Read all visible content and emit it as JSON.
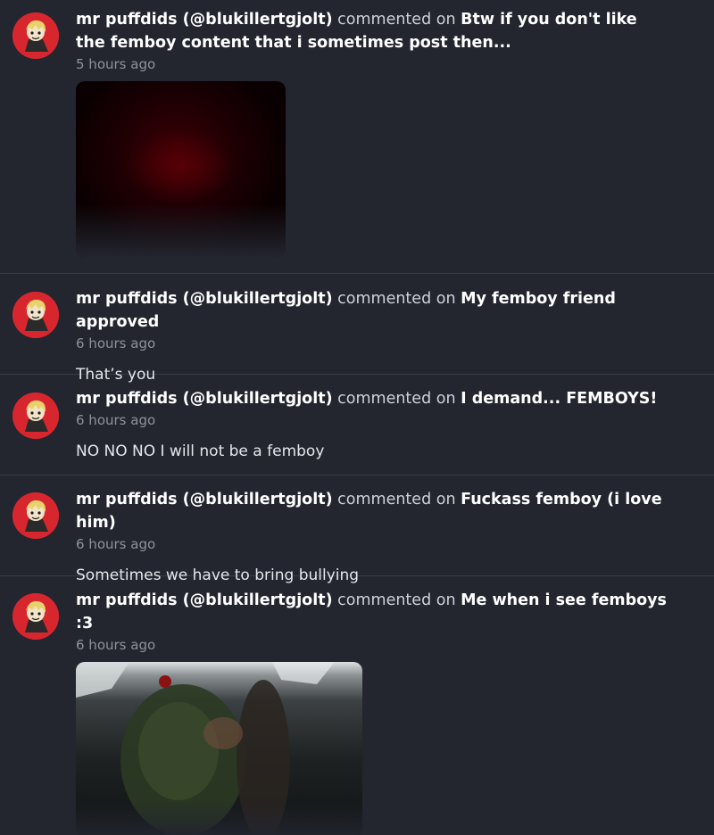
{
  "feed": {
    "items": [
      {
        "author": "mr puffdids (@blukillertgjolt)",
        "verb": "commented on",
        "post_title": "Btw if you don't like the femboy content that i sometimes post then...",
        "time": "5 hours ago",
        "text": "",
        "media": "dark red image"
      },
      {
        "author": "mr puffdids (@blukillertgjolt)",
        "verb": "commented on",
        "post_title": "My femboy friend approved",
        "time": "6 hours ago",
        "text": "That’s you"
      },
      {
        "author": "mr puffdids (@blukillertgjolt)",
        "verb": "commented on",
        "post_title": "I demand... FEMBOYS!",
        "time": "6 hours ago",
        "text": "NO NO NO  I will not be a femboy"
      },
      {
        "author": "mr puffdids (@blukillertgjolt)",
        "verb": "commented on",
        "post_title": "Fuckass femboy (i love him)",
        "time": "6 hours ago",
        "text": "Sometimes we have to bring bullying"
      },
      {
        "author": "mr puffdids (@blukillertgjolt)",
        "verb": "commented on",
        "post_title": "Me when i see femboys :3",
        "time": "6 hours ago",
        "text": "",
        "media": "dark creature image"
      }
    ]
  },
  "colors": {
    "background": "#23252f",
    "divider": "#3a3d49",
    "avatar_bg": "#d8262f",
    "time_text": "#8f929c"
  }
}
